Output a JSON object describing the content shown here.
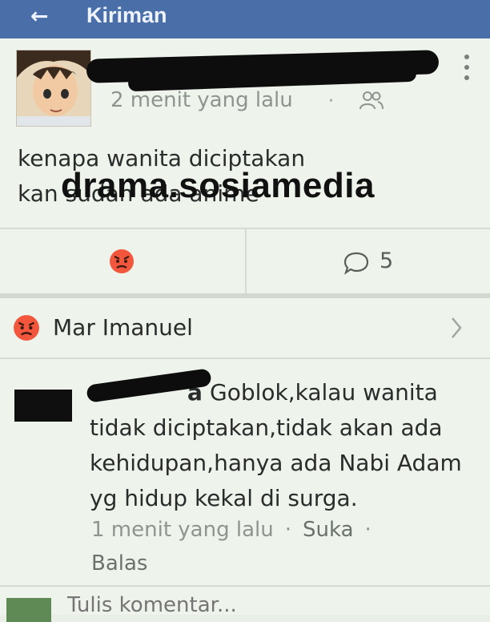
{
  "header": {
    "back_icon": "arrow-left-icon",
    "title": "Kiriman"
  },
  "post": {
    "time": "2 menit yang lalu",
    "dot": "·",
    "privacy_icon": "friends-icon",
    "lines": [
      "kenapa wanita diciptakan",
      "kan sudah ada anime"
    ],
    "reaction_icon": "angry-emoji-icon",
    "comment_icon": "speech-bubble-icon",
    "comment_count": "5"
  },
  "watermark": "drama.sosiamedia",
  "reactors": {
    "icon": "angry-emoji-icon",
    "name": "Mar Imanuel",
    "chevron_icon": "chevron-right-icon"
  },
  "comment": {
    "name_fragment": "a",
    "text": "Goblok,kalau wanita tidak diciptakan,tidak akan ada kehidupan,hanya ada Nabi Adam yg hidup kekal di surga.",
    "time": "1 menit yang lalu",
    "sep": "·",
    "like": "Suka",
    "reply": "Balas"
  },
  "composer": {
    "placeholder": "Tulis komentar..."
  },
  "colors": {
    "header_bg": "#4a6fa8",
    "page_bg": "#eef3ec",
    "redaction": "#0d0d0d",
    "angry": "#f2563c"
  }
}
